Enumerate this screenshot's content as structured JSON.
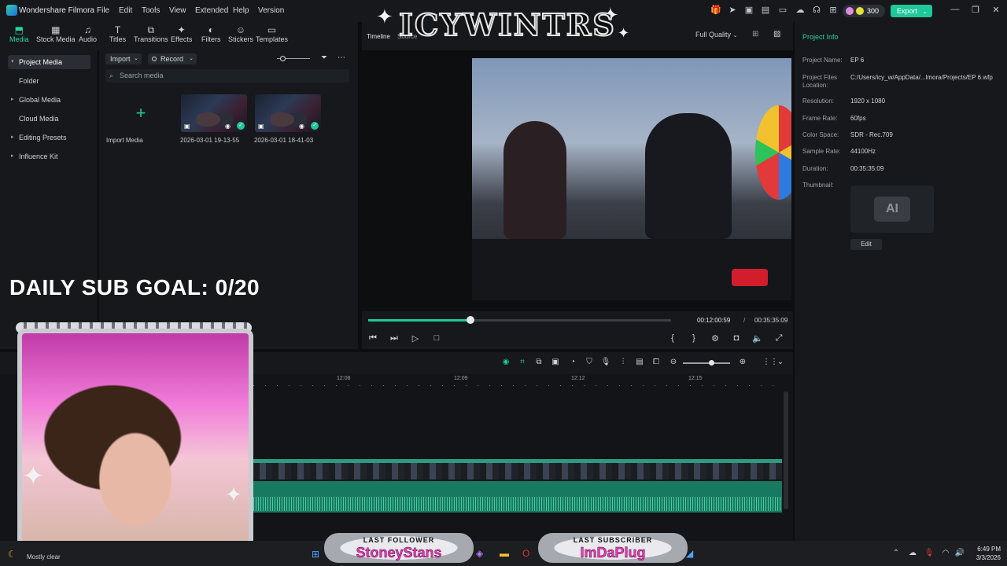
{
  "app": {
    "name": "Wondershare Filmora",
    "menu": [
      "File",
      "Edit",
      "Tools",
      "View",
      "Extended",
      "Help",
      "Version"
    ],
    "credits": "300",
    "export_label": "Export"
  },
  "toolbar": {
    "tools": [
      {
        "label": "Media",
        "icon": "media-icon"
      },
      {
        "label": "Stock Media",
        "icon": "stock-media-icon"
      },
      {
        "label": "Audio",
        "icon": "audio-icon"
      },
      {
        "label": "Titles",
        "icon": "titles-icon"
      },
      {
        "label": "Transitions",
        "icon": "transitions-icon"
      },
      {
        "label": "Effects",
        "icon": "effects-icon"
      },
      {
        "label": "Filters",
        "icon": "filters-icon"
      },
      {
        "label": "Stickers",
        "icon": "stickers-icon"
      },
      {
        "label": "Templates",
        "icon": "templates-icon"
      }
    ]
  },
  "sidebar": {
    "items": [
      {
        "label": "Project Media",
        "active": true,
        "caret": "▾"
      },
      {
        "label": "Folder"
      },
      {
        "label": "Global Media",
        "caret": "▸"
      },
      {
        "label": "Cloud Media"
      },
      {
        "label": "Editing Presets",
        "caret": "▸"
      },
      {
        "label": "Influence Kit",
        "caret": "▸"
      }
    ]
  },
  "media": {
    "import_label": "Import",
    "record_label": "Record",
    "search_placeholder": "Search media",
    "import_tile_label": "Import Media",
    "clips": [
      {
        "name": "2026-03-01 19-13-55"
      },
      {
        "name": "2026-03-01 18-41-03"
      }
    ]
  },
  "preview": {
    "tabs": [
      "Timeline",
      "Source"
    ],
    "quality": "Full Quality",
    "current_time": "00:12:00:59",
    "separator": "/",
    "total_time": "00:35:35:09",
    "progress": 0.337
  },
  "project_info": {
    "title": "Project Info",
    "fields": [
      {
        "label": "Project Name:",
        "value": "EP 6"
      },
      {
        "label": "Project Files Location:",
        "value": "C:/Users/icy_w/AppData/...lmora/Projects/EP 6.wfp"
      },
      {
        "label": "Resolution:",
        "value": "1920 x 1080"
      },
      {
        "label": "Frame Rate:",
        "value": "60fps"
      },
      {
        "label": "Color Space:",
        "value": "SDR - Rec.709"
      },
      {
        "label": "Sample Rate:",
        "value": "44100Hz"
      },
      {
        "label": "Duration:",
        "value": "00:35:35:09"
      },
      {
        "label": "Thumbnail:",
        "value": ""
      }
    ],
    "edit_label": "Edit"
  },
  "timeline": {
    "ticks": [
      "12:06",
      "12:09",
      "12:12",
      "12:15"
    ]
  },
  "overlays": {
    "logo_text": "ICYWINTRS",
    "goal_text": "DAILY SUB GOAL: 0/20",
    "last_follower": {
      "heading": "LAST FOLLOWER",
      "name": "StoneyStans"
    },
    "last_subscriber": {
      "heading": "LAST SUBSCRIBER",
      "name": "ImDaPlug"
    }
  },
  "taskbar": {
    "weather": "Mostly clear",
    "time": "6:49 PM",
    "date": "3/3/2026"
  },
  "colors": {
    "accent": "#1fc79a",
    "panel": "#16181b",
    "background": "#0d0e10"
  }
}
